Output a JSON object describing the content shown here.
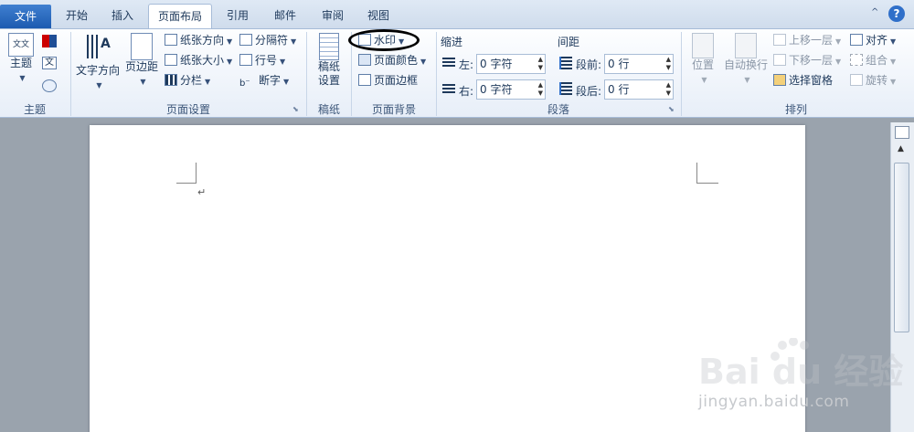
{
  "tabs": {
    "file": "文件",
    "items": [
      "开始",
      "插入",
      "页面布局",
      "引用",
      "邮件",
      "审阅",
      "视图"
    ],
    "active": "页面布局"
  },
  "groups": {
    "theme": {
      "label": "主题",
      "theme_button": "主题",
      "theme_icon_text": "文文"
    },
    "page_setup": {
      "label": "页面设置",
      "text_direction": "文字方向",
      "margins": "页边距",
      "orientation": "纸张方向",
      "size": "纸张大小",
      "columns": "分栏",
      "breaks": "分隔符",
      "line_numbers": "行号",
      "hyphenation": "断字"
    },
    "draft_paper": {
      "label": "稿纸",
      "button_line1": "稿纸",
      "button_line2": "设置"
    },
    "page_background": {
      "label": "页面背景",
      "watermark": "水印",
      "page_color": "页面颜色",
      "page_borders": "页面边框"
    },
    "paragraph": {
      "label": "段落",
      "indent_title": "缩进",
      "spacing_title": "间距",
      "left_label": "左:",
      "right_label": "右:",
      "left_value": "0 字符",
      "right_value": "0 字符",
      "before_label": "段前:",
      "after_label": "段后:",
      "before_value": "0 行",
      "after_value": "0 行"
    },
    "arrange": {
      "label": "排列",
      "position": "位置",
      "wrap": "自动换行",
      "bring_forward": "上移一层",
      "send_backward": "下移一层",
      "selection_pane": "选择窗格",
      "align": "对齐",
      "group": "组合",
      "rotate": "旋转"
    }
  },
  "document": {
    "paragraph_mark": "↵"
  },
  "watermark_overlay": {
    "logo_text": "Bai du 经验",
    "url": "jingyan.baidu.com"
  },
  "window": {
    "help": "?",
    "minimize_ribbon": "^"
  }
}
